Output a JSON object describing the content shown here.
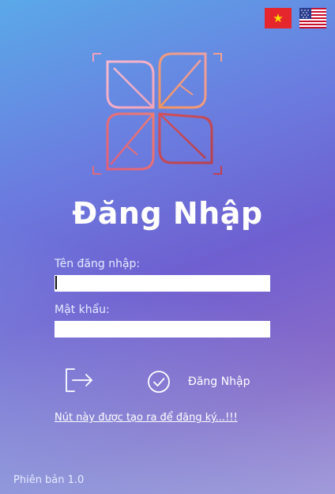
{
  "flags": {
    "vi_icon": "vietnam-flag-icon",
    "en_icon": "us-flag-icon"
  },
  "logo": {
    "icon": "leaf-logo-icon"
  },
  "title": "Đăng Nhập",
  "form": {
    "username_label": "Tên đăng nhập:",
    "username_value": "",
    "password_label": "Mật khẩu:",
    "password_value": ""
  },
  "actions": {
    "exit_icon": "exit-icon",
    "login_icon": "check-circle-icon",
    "login_label": "Đăng Nhập"
  },
  "register_link": "Nút này được tạo ra để đăng ký...!!!",
  "version": "Phiên bản 1.0",
  "colors": {
    "bg_top_left": "#5aa9e8",
    "bg_mid": "#6f5fd0",
    "bg_bottom_right": "#a58ad2",
    "logo_pink": "#f0a0b8",
    "logo_orange": "#f08a5a",
    "logo_red": "#c8464e"
  }
}
